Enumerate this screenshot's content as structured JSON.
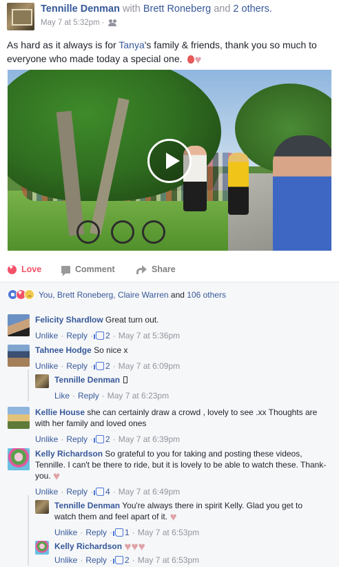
{
  "post": {
    "author": "Tennille Denman",
    "with_text": "with",
    "tagged_person": "Brett Roneberg",
    "and_text": "and",
    "others": "2 others.",
    "timestamp": "May 7 at 5:32pm",
    "separator": "·",
    "audience_icon": "friends-icon",
    "text_part1": "As hard as it always is for",
    "mention": "Tanya",
    "text_part2": "'s family & friends, thank you so much to everyone who made today a special one.",
    "video_state": "paused"
  },
  "actions": {
    "love": "Love",
    "comment": "Comment",
    "share": "Share"
  },
  "reactions": {
    "names": "You, Brett Roneberg, Claire Warren",
    "and_text": "and",
    "others": "106 others"
  },
  "comments": [
    {
      "author": "Felicity Shardlow",
      "text": "Great turn out.",
      "unlike": "Unlike",
      "reply": "Reply",
      "likes": "2",
      "time": "May 7 at 5:36pm"
    },
    {
      "author": "Tahnee Hodge",
      "text": "So nice x",
      "unlike": "Unlike",
      "reply": "Reply",
      "likes": "2",
      "time": "May 7 at 6:09pm"
    },
    {
      "author": "Tennille Denman",
      "text": "",
      "like": "Like",
      "reply": "Reply",
      "time": "May 7 at 6:23pm"
    },
    {
      "author": "Kellie House",
      "text": "she can certainly draw a crowd , lovely to see .xx Thoughts are with her family and loved ones",
      "unlike": "Unlike",
      "reply": "Reply",
      "likes": "2",
      "time": "May 7 at 6:39pm"
    },
    {
      "author": "Kelly Richardson",
      "text": "So grateful to you for taking and posting these videos, Tennille. I can't be there to ride, but it is lovely to be able to watch these. Thank-you.",
      "unlike": "Unlike",
      "reply": "Reply",
      "likes": "4",
      "time": "May 7 at 6:49pm"
    },
    {
      "author": "Tennille Denman",
      "text": "You're always there in spirit Kelly. Glad you get to watch them and feel apart of it.",
      "unlike": "Unlike",
      "reply": "Reply",
      "likes": "1",
      "time": "May 7 at 6:53pm"
    },
    {
      "author": "Kelly Richardson",
      "text": "",
      "unlike": "Unlike",
      "reply": "Reply",
      "likes": "2",
      "time": "May 7 at 6:53pm"
    }
  ],
  "colors": {
    "link": "#365899",
    "love": "#f25268",
    "meta": "#90949c",
    "comments_bg": "#f6f7f9"
  }
}
